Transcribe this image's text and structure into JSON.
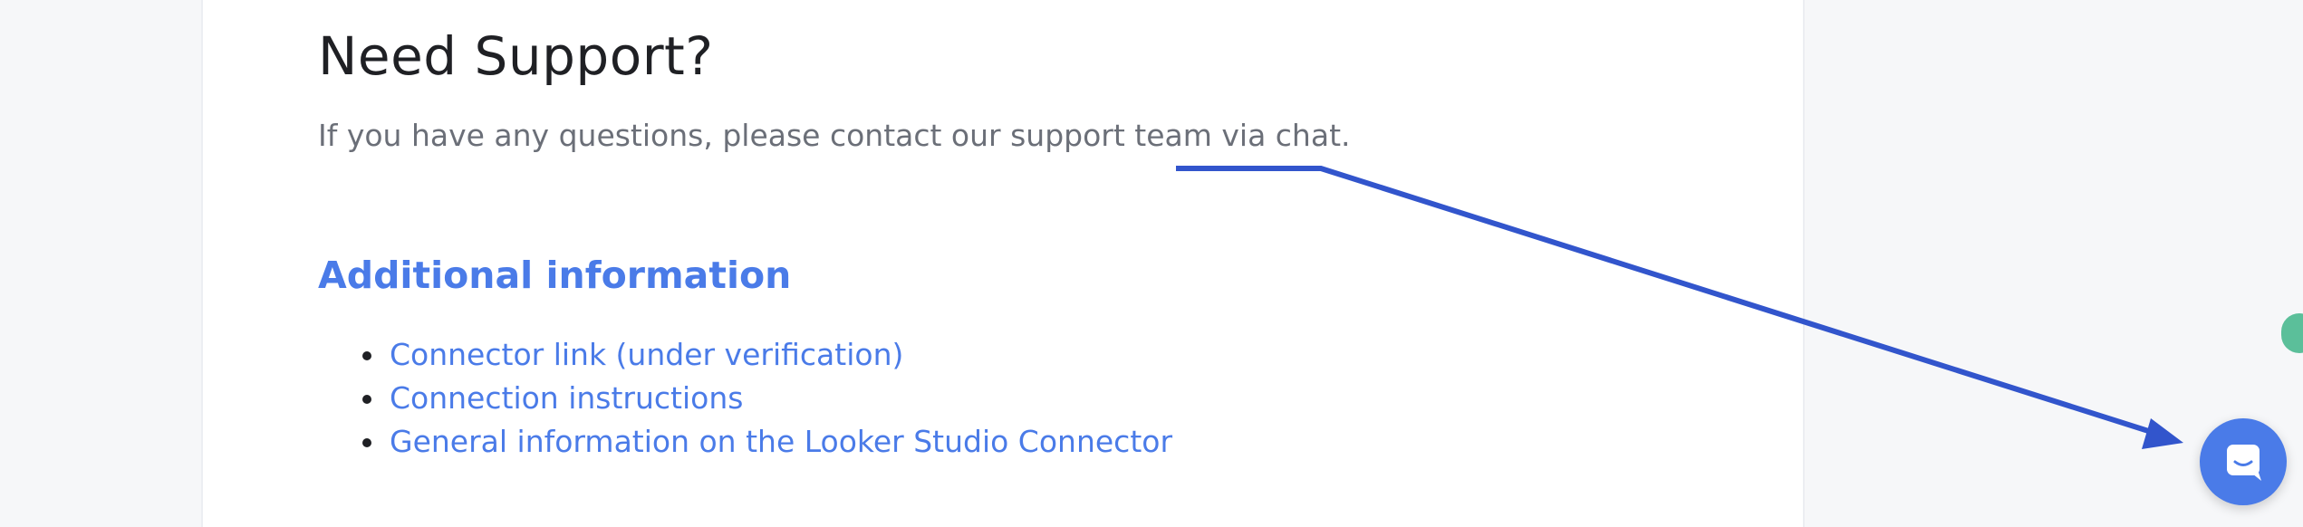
{
  "support": {
    "title": "Need Support?",
    "text": "If you have any questions, please contact our support team via chat."
  },
  "additional": {
    "title": "Additional information",
    "links": [
      "Connector link (under verification)",
      "Connection instructions",
      "General information on the Looker Studio Connector"
    ]
  },
  "colors": {
    "accent": "#4a7be8",
    "arrow": "#3255cc",
    "side_tab": "#5bbf9a"
  },
  "icons": {
    "chat_button": "chat-bubble-icon"
  }
}
